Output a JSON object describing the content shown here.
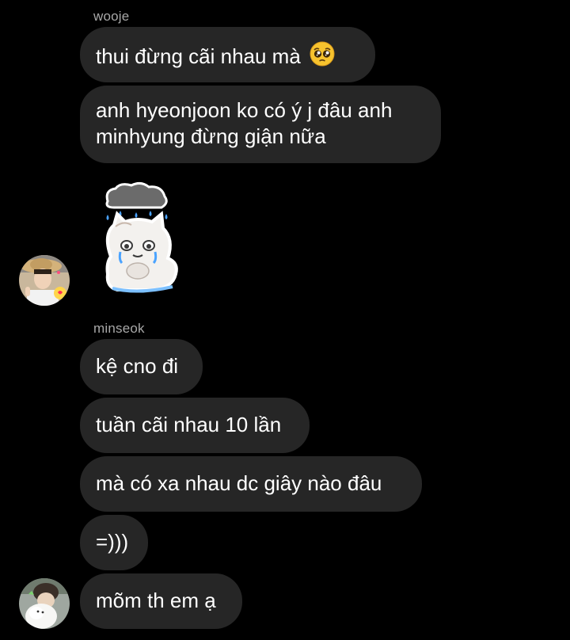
{
  "messages": {
    "group1": {
      "sender": "wooje",
      "msg1": "thui đừng cãi nhau mà",
      "msg1_emoji": "pleading-face-icon",
      "msg2": "anh hyeonjoon ko có ý j đâu anh minhyung đừng giận nữa",
      "sticker": "crying-cat-rain-cloud-sticker"
    },
    "group2": {
      "sender": "minseok",
      "msg1": "kệ cno đi",
      "msg2": "tuần cãi nhau 10 lần",
      "msg3": "mà có xa nhau dc giây nào đâu",
      "msg4": "=)))"
    },
    "group3": {
      "msg1": "mõm th em ạ"
    }
  },
  "colors": {
    "background": "#000000",
    "bubble": "#262626",
    "sender_name": "#a8a8a8",
    "text": "#ffffff"
  }
}
